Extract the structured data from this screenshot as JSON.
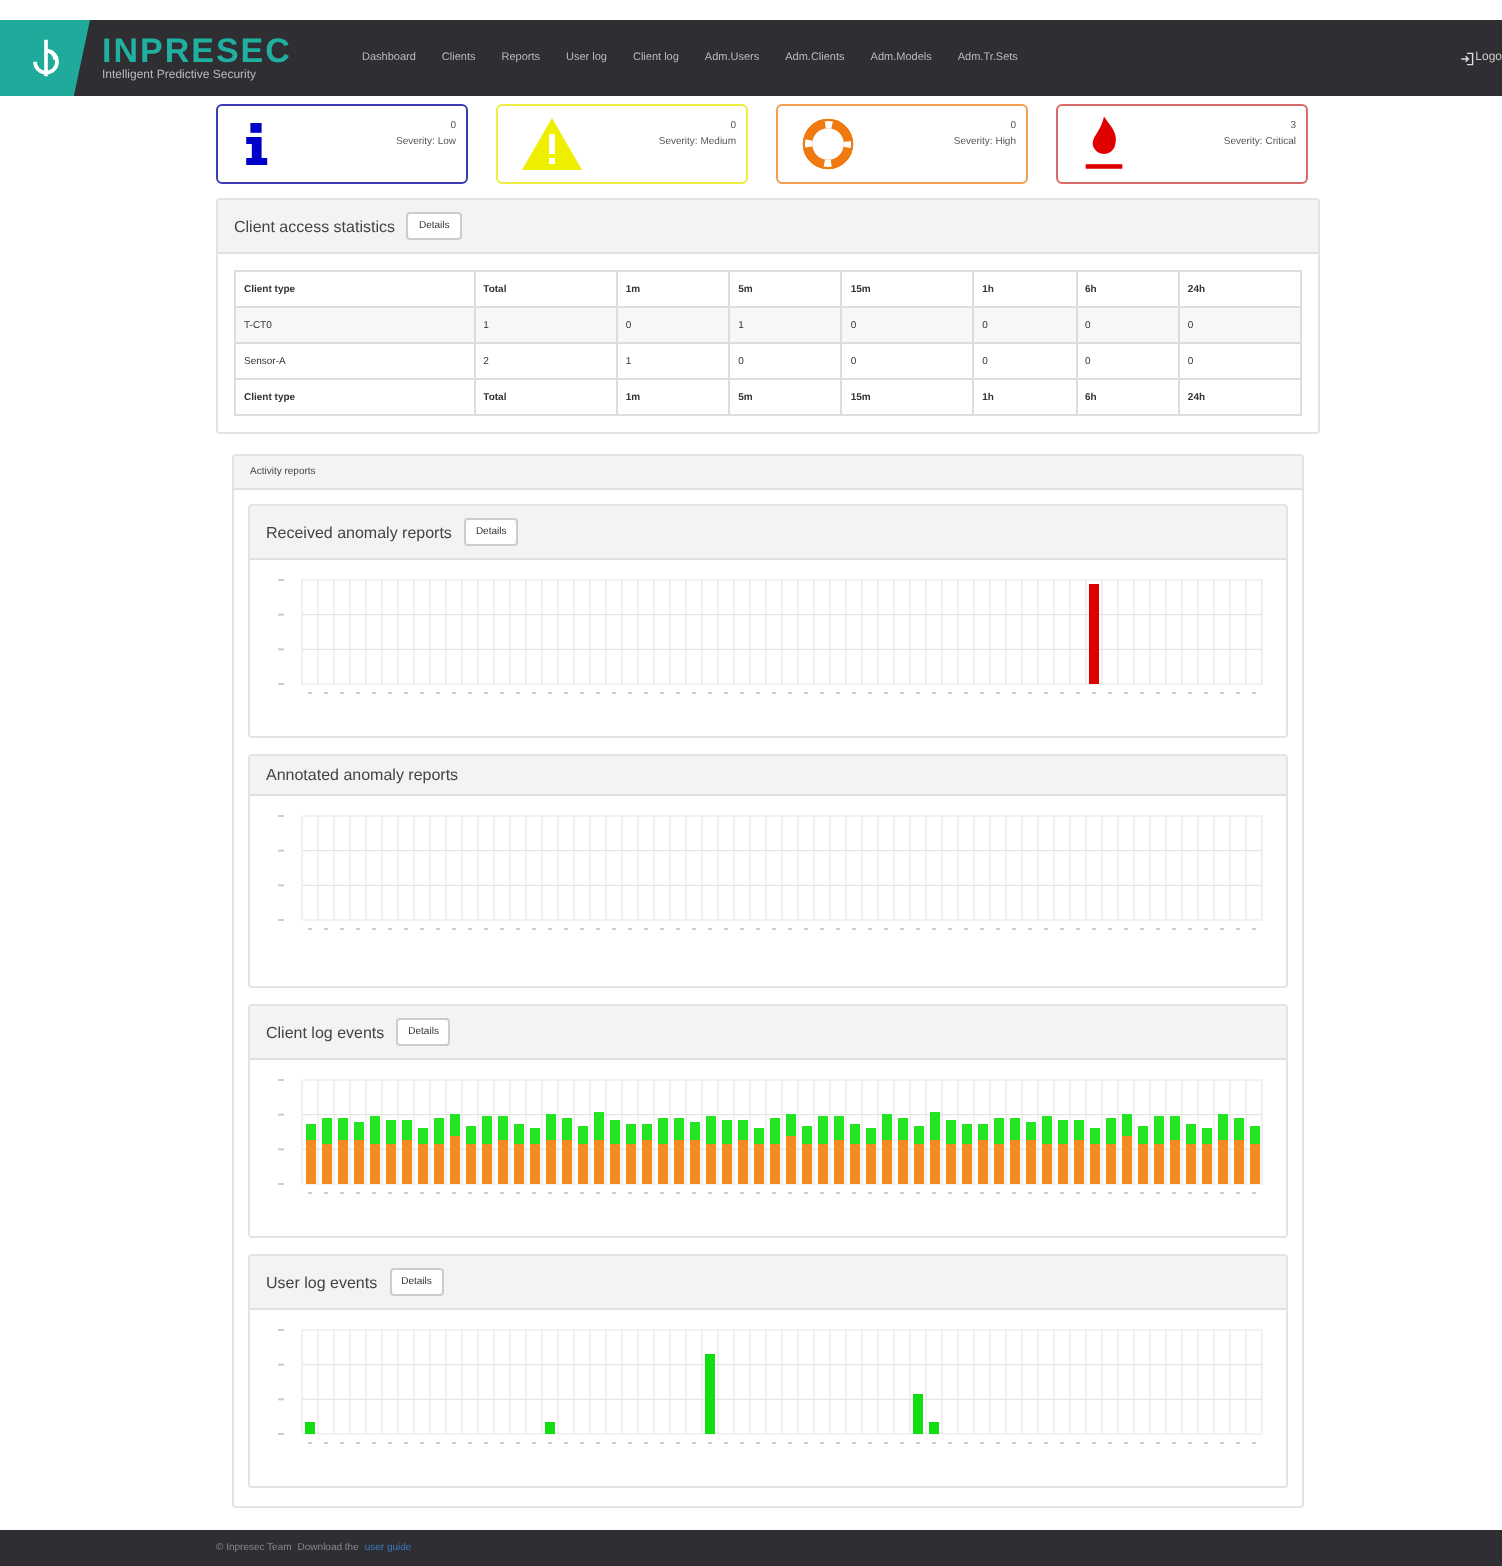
{
  "navbar": {
    "brand": "INPRESEC",
    "tagline": "Intelligent Predictive Security",
    "items": [
      {
        "label": "Dashboard"
      },
      {
        "label": "Clients"
      },
      {
        "label": "Reports"
      },
      {
        "label": "User log"
      },
      {
        "label": "Client log"
      },
      {
        "label": "Adm.Users"
      },
      {
        "label": "Adm.Clients"
      },
      {
        "label": "Adm.Models"
      },
      {
        "label": "Adm.Tr.Sets"
      }
    ],
    "logout": "Logo"
  },
  "severity_cards": [
    {
      "kind": "info",
      "count": "0",
      "label": "Severity: Low",
      "color": "#3b3bb3"
    },
    {
      "kind": "warning",
      "count": "0",
      "label": "Severity: Medium",
      "color": "#eeee44"
    },
    {
      "kind": "lifebuoy",
      "count": "0",
      "label": "Severity: High",
      "color": "#f0a050"
    },
    {
      "kind": "fire",
      "count": "3",
      "label": "Severity: Critical",
      "color": "#d86a6a"
    }
  ],
  "client_access": {
    "title": "Client access statistics",
    "button": "Details",
    "columns": [
      "Client type",
      "Total",
      "1m",
      "5m",
      "15m",
      "1h",
      "6h",
      "24h"
    ],
    "rows": [
      [
        "T-CT0",
        "1",
        "0",
        "1",
        "0",
        "0",
        "0",
        "0"
      ],
      [
        "Sensor-A",
        "2",
        "1",
        "0",
        "0",
        "0",
        "0",
        "0"
      ]
    ],
    "footer": [
      "Client type",
      "Total",
      "1m",
      "5m",
      "15m",
      "1h",
      "6h",
      "24h"
    ]
  },
  "activity_reports": {
    "title": "Activity reports",
    "panels": [
      {
        "kind": "received",
        "title": "Received anomaly reports",
        "button": "Details"
      },
      {
        "kind": "annotated",
        "title": "Annotated anomaly reports"
      },
      {
        "kind": "client_log",
        "title": "Client log events",
        "button": "Details"
      },
      {
        "kind": "user_log",
        "title": "User log events",
        "button": "Details"
      }
    ]
  },
  "footer": {
    "copyright": "© Inpresec Team",
    "link_prefix": "Download the",
    "link": "user guide"
  }
}
